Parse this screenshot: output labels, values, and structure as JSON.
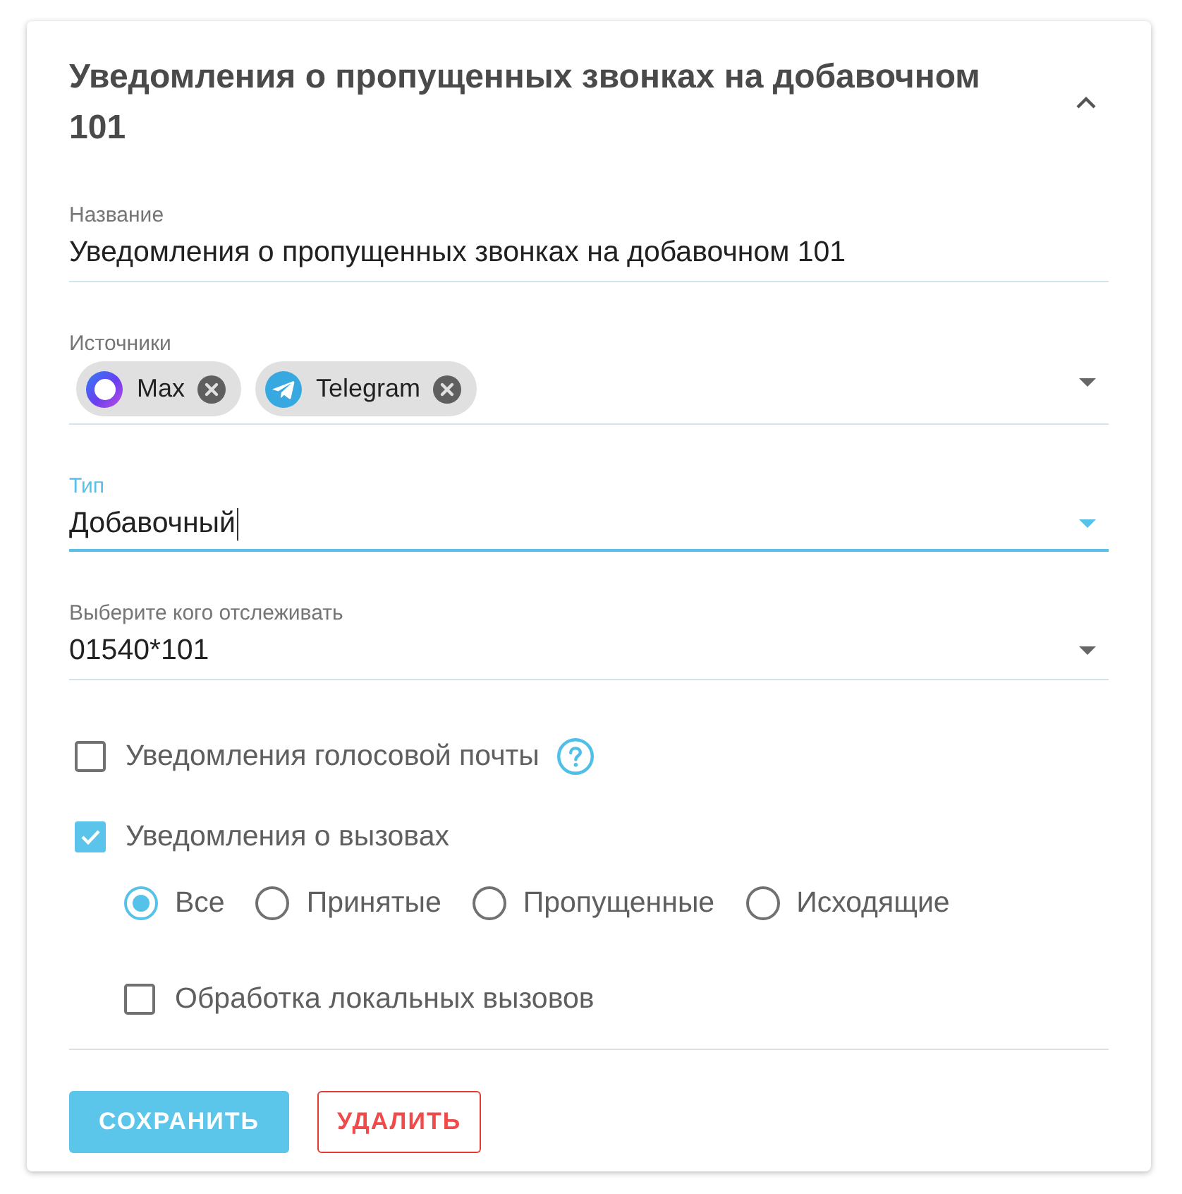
{
  "card": {
    "title": "Уведомления о пропущенных звонках на добавочном 101",
    "expanded": true
  },
  "fields": [
    {
      "kind": "text",
      "label": "Название",
      "value": "Уведомления о пропущенных звонках на добавочном 101",
      "focused": false
    },
    {
      "kind": "chips",
      "label": "Источники",
      "chips": [
        {
          "kind": "max",
          "label": "Max"
        },
        {
          "kind": "telegram",
          "label": "Telegram"
        }
      ],
      "focused": false
    },
    {
      "kind": "select",
      "label": "Тип",
      "value": "Добавочный",
      "focused": true
    },
    {
      "kind": "select",
      "label": "Выберите кого отслеживать",
      "value": "01540*101",
      "focused": false
    }
  ],
  "options": [
    {
      "kind": "checkbox",
      "label": "Уведомления голосовой почты",
      "checked": false,
      "help": true
    },
    {
      "kind": "checkbox",
      "label": "Уведомления о вызовах",
      "checked": true,
      "children": [
        {
          "kind": "radio_group",
          "options": [
            {
              "label": "Все",
              "selected": true
            },
            {
              "label": "Принятые",
              "selected": false
            },
            {
              "label": "Пропущенные",
              "selected": false
            },
            {
              "label": "Исходящие",
              "selected": false
            }
          ]
        },
        {
          "kind": "checkbox",
          "label": "Обработка локальных вызовов",
          "checked": false
        }
      ]
    }
  ],
  "buttons": [
    {
      "kind": "primary",
      "label": "СОХРАНИТЬ"
    },
    {
      "kind": "danger",
      "label": "УДАЛИТЬ"
    }
  ]
}
